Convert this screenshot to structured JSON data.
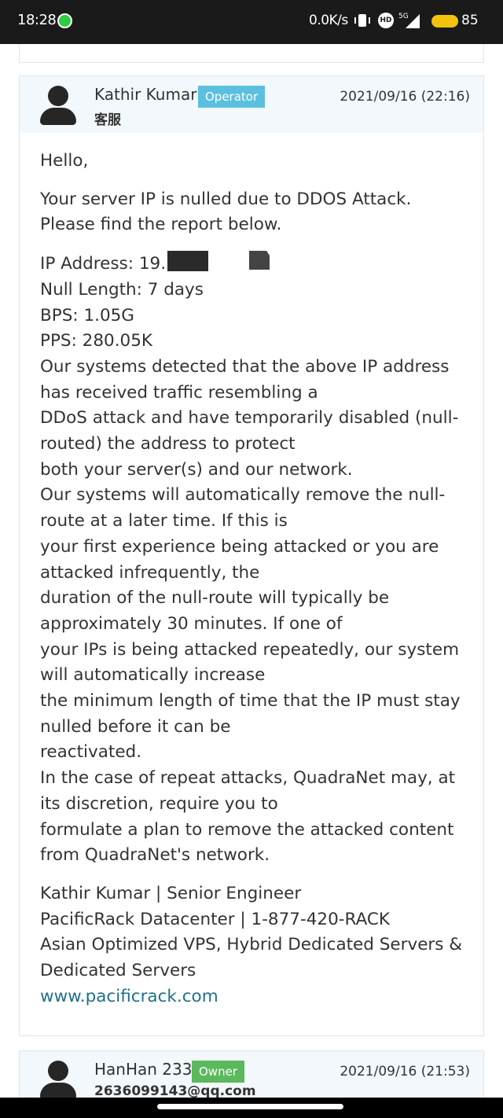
{
  "status_bar": {
    "time": "18:28",
    "network_speed": "0.0K/s",
    "hd_label": "HD",
    "signal_label": "5G",
    "battery": "85"
  },
  "posts": [
    {
      "author": "Kathir Kumar",
      "role": "Operator",
      "subtitle": "客服",
      "date": "2021/09/16 (22:16)",
      "greeting": "Hello,",
      "intro_lines": [
        "Your server IP is nulled due to DDOS Attack.",
        "Please find the report below."
      ],
      "ip_label": "IP Address: 19.",
      "report_lines": [
        "Null Length: 7 days",
        "BPS: 1.05G",
        "PPS: 280.05K",
        "Our systems detected that the above IP address has received traffic resembling a",
        "DDoS attack and have temporarily disabled (null-routed) the address to protect",
        "both your server(s) and our network.",
        "Our systems will automatically remove the null-route at a later time. If this is",
        "your first experience being attacked or you are attacked infrequently, the",
        "duration of the null-route will typically be approximately 30 minutes. If one of",
        "your IPs is being attacked repeatedly, our system will automatically increase",
        "the minimum length of time that the IP must stay nulled before it can be",
        "reactivated.",
        "In the case of repeat attacks, QuadraNet may, at its discretion, require you to",
        "formulate a plan to remove the attacked content from QuadraNet's network."
      ],
      "signature_lines": [
        "Kathir Kumar | Senior Engineer",
        "PacificRack Datacenter | 1-877-420-RACK",
        "Asian Optimized VPS, Hybrid Dedicated Servers & Dedicated Servers"
      ],
      "website": "www.pacificrack.com"
    },
    {
      "author": "HanHan 233",
      "role": "Owner",
      "subtitle": "2636099143@qq.com",
      "date": "2021/09/16 (21:53)"
    }
  ],
  "colors": {
    "operator_badge": "#5bc0de",
    "owner_badge": "#5cb85c",
    "link": "#1f6f8b",
    "header_bg": "#f2f8fc"
  }
}
